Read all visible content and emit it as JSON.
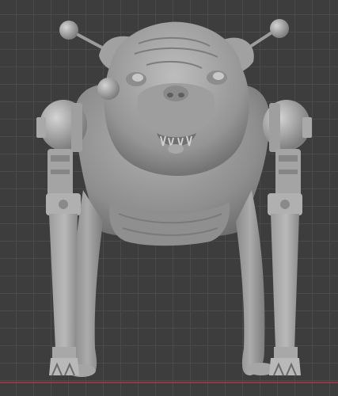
{
  "viewport": {
    "background": "#3d3d3d",
    "grid_color": "#4a4a4a",
    "x_axis_color": "#8e3a44"
  },
  "model": {
    "subject": "robot-pug-sculpt",
    "material_color": "#9a9a9a",
    "shadow_color": "#6f6f6f",
    "highlight_color": "#c2c2c2"
  }
}
